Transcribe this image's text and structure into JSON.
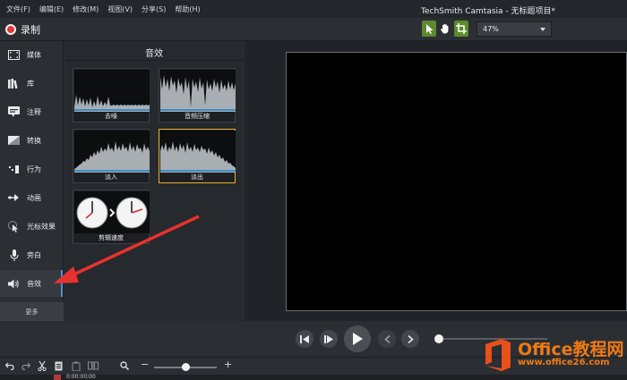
{
  "menubar": {
    "items": [
      "文件(F)",
      "编辑(E)",
      "修改(M)",
      "视图(V)",
      "分享(S)",
      "帮助(H)"
    ],
    "window_title": "TechSmith Camtasia - 无标题项目*"
  },
  "toolbar": {
    "record_label": "录制",
    "tools": [
      "pointer-icon",
      "hand-icon",
      "crop-icon"
    ],
    "zoom_value": "47%"
  },
  "tabs": [
    {
      "label": "媒体",
      "icon": "film-icon"
    },
    {
      "label": "库",
      "icon": "library-icon"
    },
    {
      "label": "注释",
      "icon": "callout-icon"
    },
    {
      "label": "转换",
      "icon": "transition-icon"
    },
    {
      "label": "行为",
      "icon": "behavior-icon"
    },
    {
      "label": "动画",
      "icon": "animation-icon"
    },
    {
      "label": "光标效果",
      "icon": "cursor-icon"
    },
    {
      "label": "旁白",
      "icon": "microphone-icon"
    },
    {
      "label": "音效",
      "icon": "speaker-icon",
      "active": true
    }
  ],
  "more_label": "更多",
  "effects_panel": {
    "title": "音效",
    "items": [
      {
        "caption": "去噪"
      },
      {
        "caption": "音频压缩"
      },
      {
        "caption": "淡入"
      },
      {
        "caption": "淡出",
        "selected": true
      },
      {
        "caption": "剪辑速度"
      }
    ]
  },
  "timeline": {
    "timecode": "0:00:00;00"
  },
  "watermark": {
    "title": "Office教程网",
    "url": "www.office26.com"
  },
  "colors": {
    "accent_green": "#5c8a2c",
    "selection_yellow": "#e9b230",
    "record_red": "#e23a3a",
    "arrow_red": "#e8322f",
    "watermark_orange": "#f07a14"
  }
}
